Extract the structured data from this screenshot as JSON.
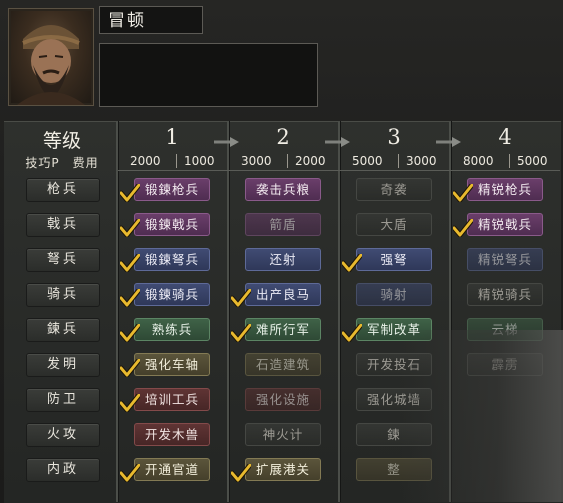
{
  "unit": {
    "name": "冒顿"
  },
  "header": {
    "level_label": "等级",
    "sub_label": "技巧P　费用",
    "levels": [
      {
        "num": "1",
        "cost_a": "2000",
        "cost_b": "1000"
      },
      {
        "num": "2",
        "cost_a": "3000",
        "cost_b": "2000"
      },
      {
        "num": "3",
        "cost_a": "5000",
        "cost_b": "3000"
      },
      {
        "num": "4",
        "cost_a": "8000",
        "cost_b": "5000"
      }
    ]
  },
  "rows": [
    {
      "label": "枪兵",
      "cells": [
        {
          "text": "锻鍊枪兵",
          "color": "purple",
          "checked": true,
          "dim": false
        },
        {
          "text": "袭击兵粮",
          "color": "purple",
          "checked": false,
          "dim": false
        },
        {
          "text": "奇袭",
          "color": "dark",
          "checked": false,
          "dim": false
        },
        {
          "text": "精锐枪兵",
          "color": "purple",
          "checked": true,
          "dim": false
        }
      ]
    },
    {
      "label": "戟兵",
      "cells": [
        {
          "text": "锻鍊戟兵",
          "color": "purple",
          "checked": true,
          "dim": false
        },
        {
          "text": "箭盾",
          "color": "purple",
          "checked": false,
          "dim": true
        },
        {
          "text": "大盾",
          "color": "dark",
          "checked": false,
          "dim": false
        },
        {
          "text": "精锐戟兵",
          "color": "purple",
          "checked": true,
          "dim": false
        }
      ]
    },
    {
      "label": "弩兵",
      "cells": [
        {
          "text": "锻鍊弩兵",
          "color": "blue",
          "checked": true,
          "dim": false
        },
        {
          "text": "还射",
          "color": "blue",
          "checked": false,
          "dim": false
        },
        {
          "text": "强弩",
          "color": "blue",
          "checked": true,
          "dim": false
        },
        {
          "text": "精锐弩兵",
          "color": "blue",
          "checked": false,
          "dim": true
        }
      ]
    },
    {
      "label": "骑兵",
      "cells": [
        {
          "text": "锻鍊骑兵",
          "color": "blue",
          "checked": true,
          "dim": false
        },
        {
          "text": "出产良马",
          "color": "blue",
          "checked": true,
          "dim": false
        },
        {
          "text": "骑射",
          "color": "blue",
          "checked": false,
          "dim": true
        },
        {
          "text": "精锐骑兵",
          "color": "dark",
          "checked": false,
          "dim": false
        }
      ]
    },
    {
      "label": "鍊兵",
      "cells": [
        {
          "text": "熟练兵",
          "color": "green",
          "checked": true,
          "dim": false
        },
        {
          "text": "难所行军",
          "color": "green",
          "checked": true,
          "dim": false
        },
        {
          "text": "军制改革",
          "color": "green",
          "checked": true,
          "dim": false
        },
        {
          "text": "云梯",
          "color": "green",
          "checked": false,
          "dim": true
        }
      ]
    },
    {
      "label": "发明",
      "cells": [
        {
          "text": "强化车轴",
          "color": "gold",
          "checked": true,
          "dim": false
        },
        {
          "text": "石造建筑",
          "color": "gold",
          "checked": false,
          "dim": true
        },
        {
          "text": "开发投石",
          "color": "dark",
          "checked": false,
          "dim": false
        },
        {
          "text": "霹雳",
          "color": "dark",
          "checked": false,
          "dim": false
        }
      ]
    },
    {
      "label": "防卫",
      "cells": [
        {
          "text": "培训工兵",
          "color": "red",
          "checked": true,
          "dim": false
        },
        {
          "text": "强化设施",
          "color": "red",
          "checked": false,
          "dim": true
        },
        {
          "text": "强化城墙",
          "color": "dark",
          "checked": false,
          "dim": false
        },
        {
          "text": "",
          "color": "none",
          "checked": false,
          "dim": false
        }
      ]
    },
    {
      "label": "火攻",
      "cells": [
        {
          "text": "开发木兽",
          "color": "red",
          "checked": false,
          "dim": false
        },
        {
          "text": "神火计",
          "color": "dark",
          "checked": false,
          "dim": false
        },
        {
          "text": "鍊",
          "color": "dark",
          "checked": false,
          "dim": false
        },
        {
          "text": "",
          "color": "none",
          "checked": false,
          "dim": false
        }
      ]
    },
    {
      "label": "内政",
      "cells": [
        {
          "text": "开通官道",
          "color": "gold",
          "checked": true,
          "dim": false
        },
        {
          "text": "扩展港关",
          "color": "gold",
          "checked": true,
          "dim": false
        },
        {
          "text": "整",
          "color": "gold",
          "checked": false,
          "dim": true
        },
        {
          "text": "",
          "color": "none",
          "checked": false,
          "dim": false
        }
      ]
    }
  ]
}
